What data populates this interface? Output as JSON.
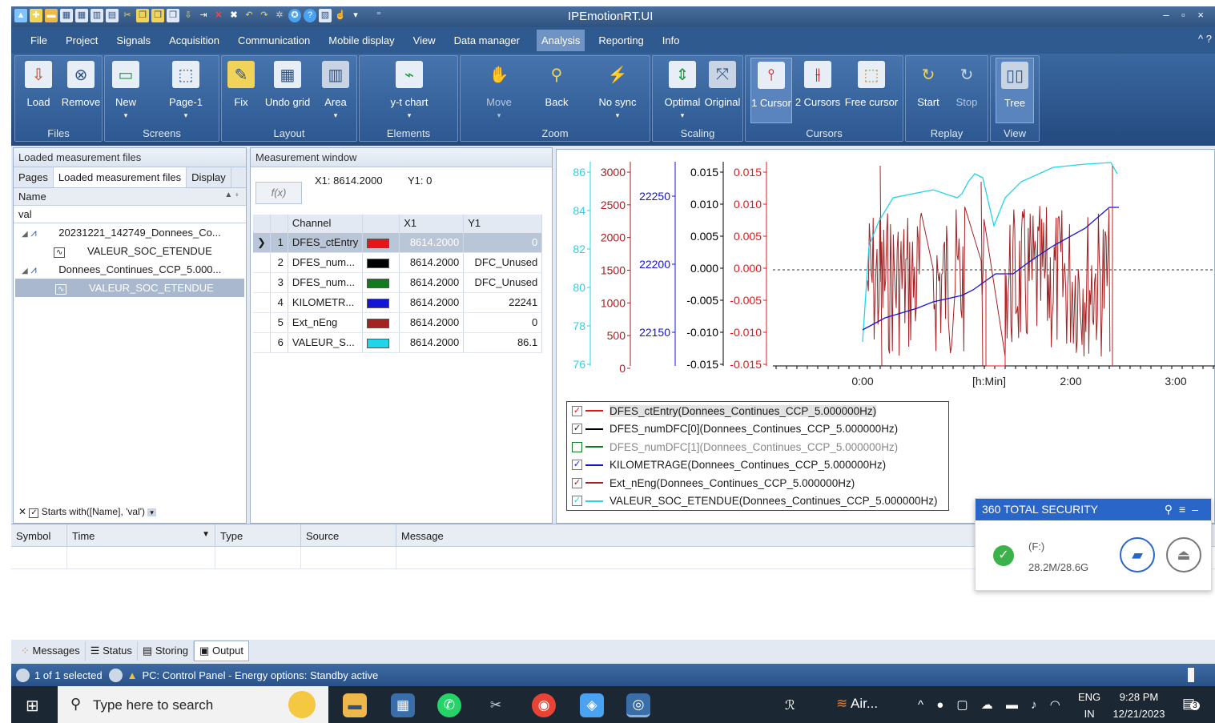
{
  "window": {
    "title": "IPEmotionRT.UI",
    "controls": "– ▫ ×"
  },
  "menu": {
    "items": [
      "File",
      "Project",
      "Signals",
      "Acquisition",
      "Communication",
      "Mobile display",
      "View",
      "Data manager",
      "Analysis",
      "Reporting",
      "Info"
    ],
    "active": "Analysis",
    "help": "^ ?"
  },
  "ribbon": {
    "groups": [
      {
        "label": "Files",
        "buttons": [
          "Load",
          "Remove"
        ]
      },
      {
        "label": "Screens",
        "buttons": [
          "New",
          "Page-1"
        ]
      },
      {
        "label": "Layout",
        "buttons": [
          "Fix",
          "Undo grid",
          "Area"
        ]
      },
      {
        "label": "Elements",
        "buttons": [
          "y-t chart"
        ]
      },
      {
        "label": "Zoom",
        "buttons": [
          "Move",
          "Back",
          "No sync"
        ]
      },
      {
        "label": "Scaling",
        "buttons": [
          "Optimal",
          "Original"
        ]
      },
      {
        "label": "Cursors",
        "buttons": [
          "1 Cursor",
          "2 Cursors",
          "Free cursor"
        ]
      },
      {
        "label": "Replay",
        "buttons": [
          "Start",
          "Stop"
        ]
      },
      {
        "label": "View",
        "buttons": [
          "Tree"
        ]
      }
    ]
  },
  "left_panel": {
    "header": "Loaded measurement files",
    "tabs": [
      "Pages",
      "Loaded measurement files",
      "Display"
    ],
    "col_name": "Name",
    "filter_value": "val",
    "tree": [
      {
        "label": "20231221_142749_Donnees_Co...",
        "level": 0
      },
      {
        "label": "VALEUR_SOC_ETENDUE",
        "level": 1
      },
      {
        "label": "Donnees_Continues_CCP_5.000...",
        "level": 0
      },
      {
        "label": "VALEUR_SOC_ETENDUE",
        "level": 1,
        "selected": true
      }
    ],
    "filter_text": "Starts with([Name], 'val')"
  },
  "measure_panel": {
    "header": "Measurement window",
    "fx": "f(x)",
    "x1": "X1: 8614.2000",
    "y1": "Y1: 0",
    "columns": [
      "Channel",
      "X1",
      "Y1"
    ],
    "rows": [
      {
        "n": "1",
        "name": "DFES_ctEntry",
        "color": "#e8141a",
        "x1": "8614.2000",
        "y1": "0"
      },
      {
        "n": "2",
        "name": "DFES_num...",
        "color": "#000000",
        "x1": "8614.2000",
        "y1": "DFC_Unused"
      },
      {
        "n": "3",
        "name": "DFES_num...",
        "color": "#117a1e",
        "x1": "8614.2000",
        "y1": "DFC_Unused"
      },
      {
        "n": "4",
        "name": "KILOMETR...",
        "color": "#1414d8",
        "x1": "8614.2000",
        "y1": "22241"
      },
      {
        "n": "5",
        "name": "Ext_nEng",
        "color": "#a32222",
        "x1": "8614.2000",
        "y1": "0"
      },
      {
        "n": "6",
        "name": "VALEUR_S...",
        "color": "#22d4e8",
        "x1": "8614.2000",
        "y1": "86.1"
      }
    ]
  },
  "chart_data": {
    "type": "line",
    "x_ticks": [
      "0:00",
      "[h:Min]",
      "2:00",
      "3:00"
    ],
    "axes": [
      {
        "color": "#22d4e8",
        "ticks": [
          "86",
          "84",
          "82",
          "80",
          "78",
          "76"
        ]
      },
      {
        "color": "#a32222",
        "ticks": [
          "3000",
          "2500",
          "2000",
          "1500",
          "1000",
          "500",
          "0"
        ]
      },
      {
        "color": "#1414d8",
        "ticks": [
          "22250",
          "22200",
          "22150"
        ]
      },
      {
        "color": "#000000",
        "ticks": [
          "0.015",
          "0.010",
          "0.005",
          "0.000",
          "-0.005",
          "-0.010",
          "-0.015"
        ]
      },
      {
        "color": "#e8141a",
        "ticks": [
          "0.015",
          "0.010",
          "0.005",
          "0.000",
          "-0.005",
          "-0.010",
          "-0.015"
        ]
      }
    ],
    "series": [
      {
        "name": "DFES_ctEntry(Donnees_Continues_CCP_5.000000Hz)",
        "color": "#e8141a",
        "checked": true
      },
      {
        "name": "DFES_numDFC[0](Donnees_Continues_CCP_5.000000Hz)",
        "color": "#000000",
        "checked": true
      },
      {
        "name": "DFES_numDFC[1](Donnees_Continues_CCP_5.000000Hz)",
        "color": "#117a1e",
        "checked": false
      },
      {
        "name": "KILOMETRAGE(Donnees_Continues_CCP_5.000000Hz)",
        "color": "#1414d8",
        "checked": true
      },
      {
        "name": "Ext_nEng(Donnees_Continues_CCP_5.000000Hz)",
        "color": "#a32222",
        "checked": true
      },
      {
        "name": "VALEUR_SOC_ETENDUE(Donnees_Continues_CCP_5.000000Hz)",
        "color": "#22d4e8",
        "checked": true
      }
    ]
  },
  "messages": {
    "columns": [
      "Symbol",
      "Time",
      "Type",
      "Source",
      "Message"
    ]
  },
  "bottom_tabs": [
    "Messages",
    "Status",
    "Storing",
    "Output"
  ],
  "status": {
    "selected": "1 of 1 selected",
    "warning": "PC: Control Panel - Energy options: Standby active"
  },
  "security": {
    "title": "360 TOTAL SECURITY",
    "drive": "(F:)",
    "size": "28.2M/28.6G"
  },
  "taskbar": {
    "search": "Type here to search",
    "app": "Air...",
    "lang1": "ENG",
    "lang2": "IN",
    "time": "9:28 PM",
    "date": "12/21/2023",
    "notif": "3"
  }
}
